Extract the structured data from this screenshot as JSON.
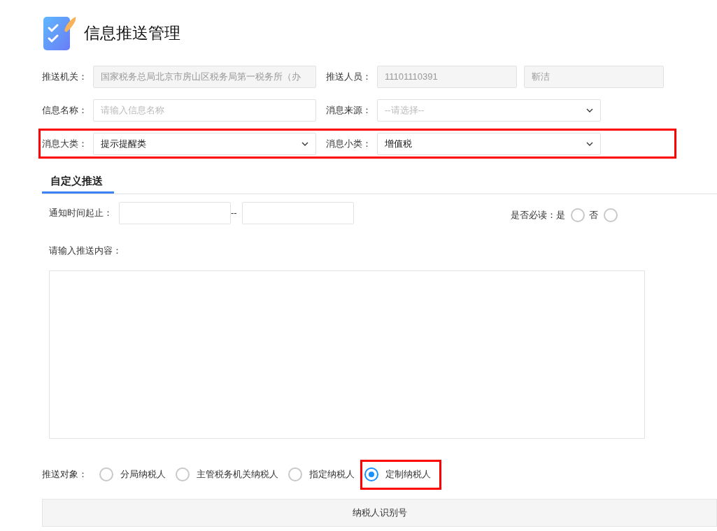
{
  "page_title": "信息推送管理",
  "form_rows": [
    {
      "highlighted": false,
      "fields": [
        {
          "label": "推送机关：",
          "kind": "readonly",
          "value": "国家税务总局北京市房山区税务局第一税务所（办"
        },
        {
          "label": "推送人员：",
          "kind": "readonly",
          "value": "11101110391",
          "extra_value": "靳洁"
        }
      ]
    },
    {
      "highlighted": false,
      "fields": [
        {
          "label": "信息名称：",
          "kind": "input",
          "placeholder": "请输入信息名称"
        },
        {
          "label": "消息来源：",
          "kind": "select",
          "placeholder": "--请选择--"
        }
      ]
    },
    {
      "highlighted": true,
      "fields": [
        {
          "label": "消息大类：",
          "kind": "select",
          "value": "提示提醒类"
        },
        {
          "label": "消息小类：",
          "kind": "select",
          "value": "增值税"
        }
      ]
    }
  ],
  "tabs": [
    {
      "label": "自定义推送",
      "selected": true
    }
  ],
  "notify_time": {
    "label": "通知时间起止：",
    "separator": "--"
  },
  "must_read": {
    "label": "是否必读：",
    "options": [
      {
        "label": "是",
        "selected": false
      },
      {
        "label": "否",
        "selected": false
      }
    ]
  },
  "content": {
    "label": "请输入推送内容："
  },
  "push_target": {
    "label": "推送对象：",
    "options": [
      {
        "label": "分局纳税人",
        "selected": false,
        "highlighted": false
      },
      {
        "label": "主管税务机关纳税人",
        "selected": false,
        "highlighted": false
      },
      {
        "label": "指定纳税人",
        "selected": false,
        "highlighted": false
      },
      {
        "label": "定制纳税人",
        "selected": true,
        "highlighted": true
      }
    ]
  },
  "table": {
    "columns": [
      "纳税人识别号"
    ]
  }
}
